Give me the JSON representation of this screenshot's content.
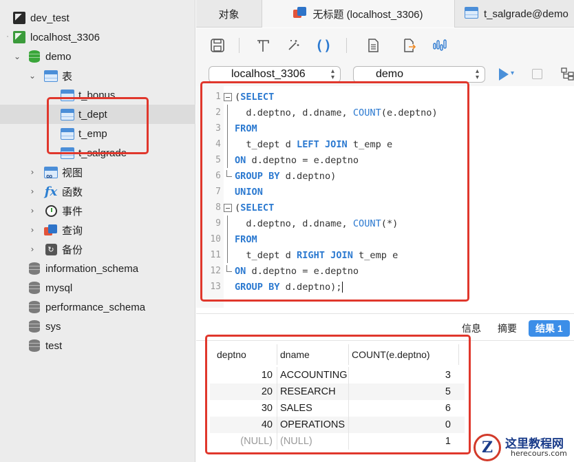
{
  "sidebar": {
    "connections": [
      {
        "label": "dev_test"
      },
      {
        "label": "localhost_3306"
      }
    ],
    "db_demo": "demo",
    "tables_group": "表",
    "tables": [
      "t_bonus",
      "t_dept",
      "t_emp",
      "t_salgrade"
    ],
    "groups": [
      "视图",
      "函数",
      "事件",
      "查询",
      "备份"
    ],
    "databases": [
      "information_schema",
      "mysql",
      "performance_schema",
      "sys",
      "test"
    ]
  },
  "tabs": [
    {
      "label": "对象"
    },
    {
      "label": "无标题 (localhost_3306)"
    },
    {
      "label": "t_salgrade@demo"
    }
  ],
  "selectors": {
    "connection": "localhost_3306",
    "database": "demo"
  },
  "editor": {
    "line_numbers": [
      "1",
      "2",
      "3",
      "4",
      "5",
      "6",
      "7",
      "8",
      "9",
      "10",
      "11",
      "12",
      "13"
    ]
  },
  "result_tabs": {
    "info": "信息",
    "summary": "摘要",
    "result": "结果 1"
  },
  "grid": {
    "columns": [
      "deptno",
      "dname",
      "COUNT(e.deptno)"
    ],
    "rows": [
      {
        "deptno": "10",
        "dname": "ACCOUNTING",
        "count": "3"
      },
      {
        "deptno": "20",
        "dname": "RESEARCH",
        "count": "5"
      },
      {
        "deptno": "30",
        "dname": "SALES",
        "count": "6"
      },
      {
        "deptno": "40",
        "dname": "OPERATIONS",
        "count": "0"
      },
      {
        "deptno": "(NULL)",
        "dname": "(NULL)",
        "count": "1"
      }
    ]
  },
  "watermark": {
    "title": "这里教程网",
    "url": "herecours.com"
  },
  "colors": {
    "keyword": "#2b79d0",
    "accent": "#3c8ee8",
    "highlight": "#e0372c"
  }
}
